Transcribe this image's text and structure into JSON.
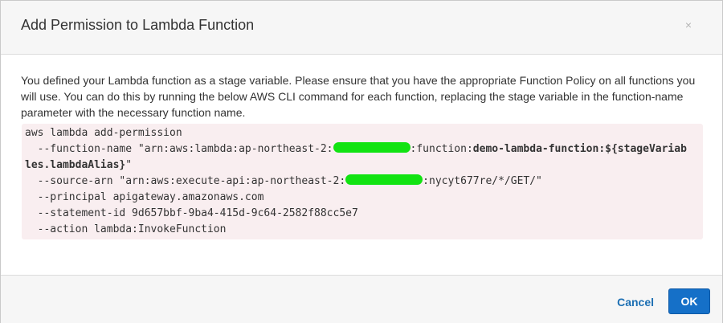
{
  "dialog": {
    "title": "Add Permission to Lambda Function",
    "close_label": "×"
  },
  "description": "You defined your Lambda function as a stage variable. Please ensure that you have the appropriate Function Policy on all functions you will use. You can do this by running the below AWS CLI command for each function, replacing the stage variable in the function-name parameter with the necessary function name.",
  "command": {
    "line1": "aws lambda add-permission",
    "fn_prefix": "  --function-name \"arn:aws:lambda:ap-northeast-2:",
    "fn_mid": ":function:",
    "fn_name_bold": "demo-lambda-function:${stageVariab",
    "fn_cont_bold": "les.lambdaAlias}",
    "fn_end": "\"",
    "src_prefix": "  --source-arn \"arn:aws:execute-api:ap-northeast-2:",
    "src_suffix": ":nycyt677re/*/GET/\"",
    "principal": "  --principal apigateway.amazonaws.com",
    "statement": "  --statement-id 9d657bbf-9ba4-415d-9c64-2582f88cc5e7",
    "action": "  --action lambda:InvokeFunction",
    "redaction_color": "#12e312"
  },
  "footer": {
    "cancel_label": "Cancel",
    "ok_label": "OK"
  },
  "colors": {
    "accent": "#1570c8",
    "link": "#1c6fb3",
    "code_bg": "#f9eef0"
  }
}
